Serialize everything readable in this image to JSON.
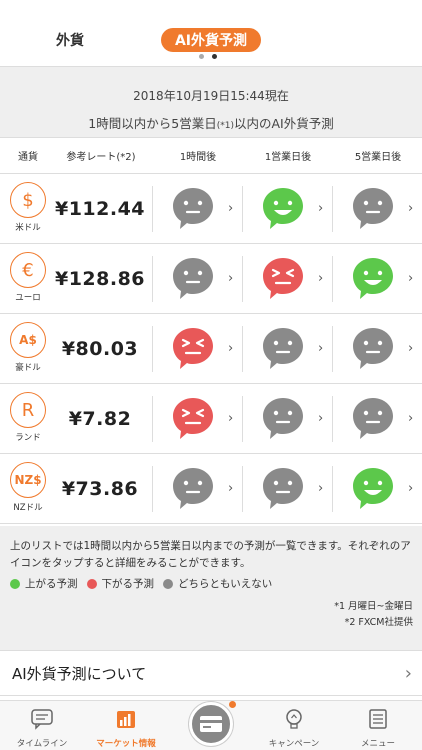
{
  "tabs": {
    "forex": "外貨",
    "ai_forecast": "AI外貨予測"
  },
  "info": {
    "timestamp": "2018年10月19日15:44現在",
    "description_pre": "1時間以内から5営業日",
    "description_sup": "(*1)",
    "description_post": "以内のAI外貨予測"
  },
  "table_headers": {
    "currency": "通貨",
    "rate": "参考レート(*2)",
    "h1": "1時間後",
    "d1": "1営業日後",
    "d5": "5営業日後"
  },
  "rows": [
    {
      "symbol": "$",
      "name": "米ドル",
      "rate": "¥112.44",
      "h1": "neutral",
      "d1": "up",
      "d5": "neutral"
    },
    {
      "symbol": "€",
      "name": "ユーロ",
      "rate": "¥128.86",
      "h1": "neutral",
      "d1": "down",
      "d5": "up"
    },
    {
      "symbol": "A$",
      "name": "豪ドル",
      "rate": "¥80.03",
      "h1": "down",
      "d1": "neutral",
      "d5": "neutral"
    },
    {
      "symbol": "R",
      "name": "ランド",
      "rate": "¥7.82",
      "h1": "down",
      "d1": "neutral",
      "d5": "neutral"
    },
    {
      "symbol": "NZ$",
      "name": "NZドル",
      "rate": "¥73.86",
      "h1": "neutral",
      "d1": "neutral",
      "d5": "up"
    }
  ],
  "notes": {
    "text": "上のリストでは1時間以内から5営業日以内までの予測が一覧できます。それぞれのアイコンをタップすると詳細をみることができます。",
    "legend_up": "上がる予測",
    "legend_down": "下がる予測",
    "legend_neutral": "どちらともいえない",
    "footnote1": "*1 月曜日~金曜日",
    "footnote2": "*2 FXCM社提供"
  },
  "about_label": "AI外貨予測について",
  "nav": {
    "timeline": "タイムライン",
    "market": "マーケット情報",
    "campaign": "キャンペーン",
    "menu": "メニュー"
  },
  "colors": {
    "accent": "#f07a2d",
    "up": "#5cc84b",
    "down": "#e85858",
    "neutral": "#8a8a8a"
  }
}
